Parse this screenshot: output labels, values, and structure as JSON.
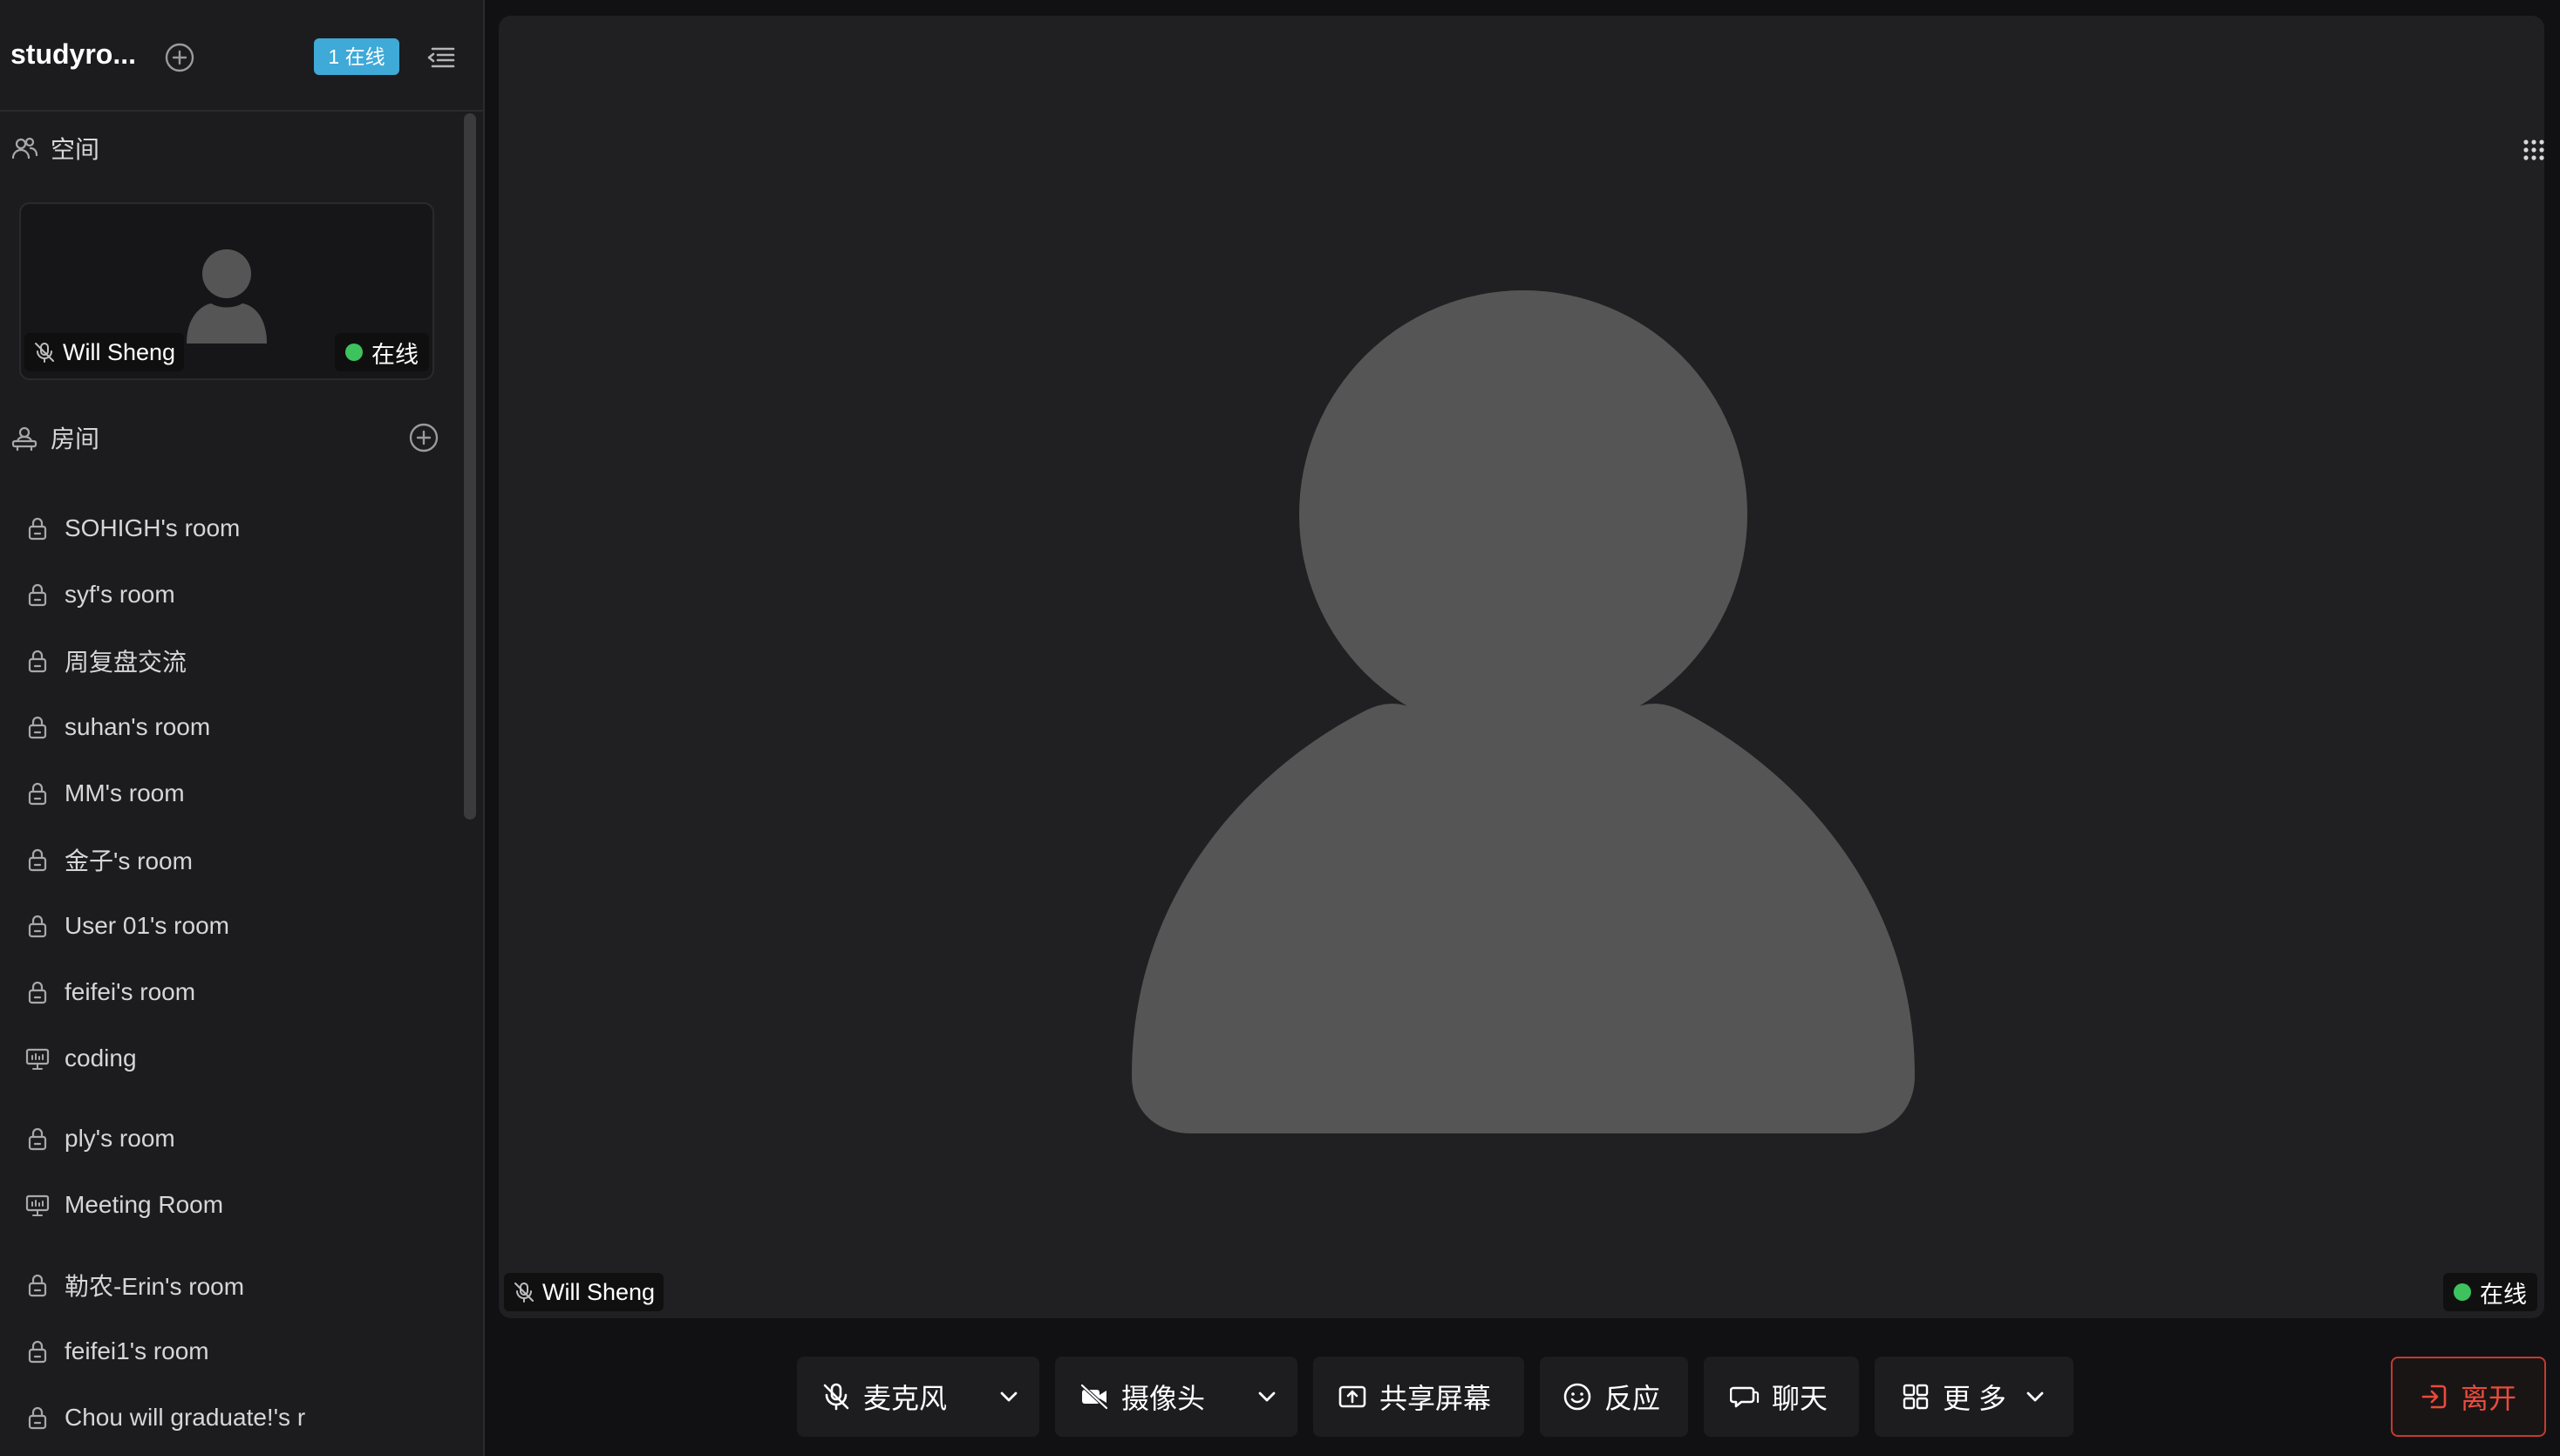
{
  "sidebar": {
    "space_name": "studyro...",
    "online_badge": "1 在线",
    "space_section_title": "空间",
    "user_card": {
      "name": "Will Sheng",
      "status": "在线"
    },
    "rooms_section_title": "房间",
    "rooms": [
      {
        "label": "SOHIGH's room",
        "icon": "lock-icon"
      },
      {
        "label": "syf's room",
        "icon": "lock-icon"
      },
      {
        "label": "周复盘交流",
        "icon": "lock-icon"
      },
      {
        "label": "suhan's room",
        "icon": "lock-icon"
      },
      {
        "label": "MM's room",
        "icon": "lock-icon"
      },
      {
        "label": "金子's room",
        "icon": "lock-icon"
      },
      {
        "label": "User 01's room",
        "icon": "lock-icon"
      },
      {
        "label": "feifei's room",
        "icon": "lock-icon"
      },
      {
        "label": "coding",
        "icon": "presentation-icon"
      },
      {
        "label": "ply's room",
        "icon": "lock-icon"
      },
      {
        "label": "Meeting Room",
        "icon": "presentation-icon"
      },
      {
        "label": "勒农-Erin's room",
        "icon": "lock-icon"
      },
      {
        "label": "feifei1's room",
        "icon": "lock-icon"
      },
      {
        "label": "Chou will graduate!'s r",
        "icon": "lock-icon"
      }
    ]
  },
  "stage": {
    "participant_name": "Will Sheng",
    "participant_status": "在线"
  },
  "toolbar": {
    "mic_label": "麦克风",
    "camera_label": "摄像头",
    "share_label": "共享屏幕",
    "reaction_label": "反应",
    "chat_label": "聊天",
    "more_label": "更 多",
    "leave_label": "离开"
  },
  "colors": {
    "accent_badge": "#3fa9d8",
    "online_dot": "#3ec25e",
    "leave_red": "#ea4b3c",
    "avatar_gray": "#555555"
  }
}
